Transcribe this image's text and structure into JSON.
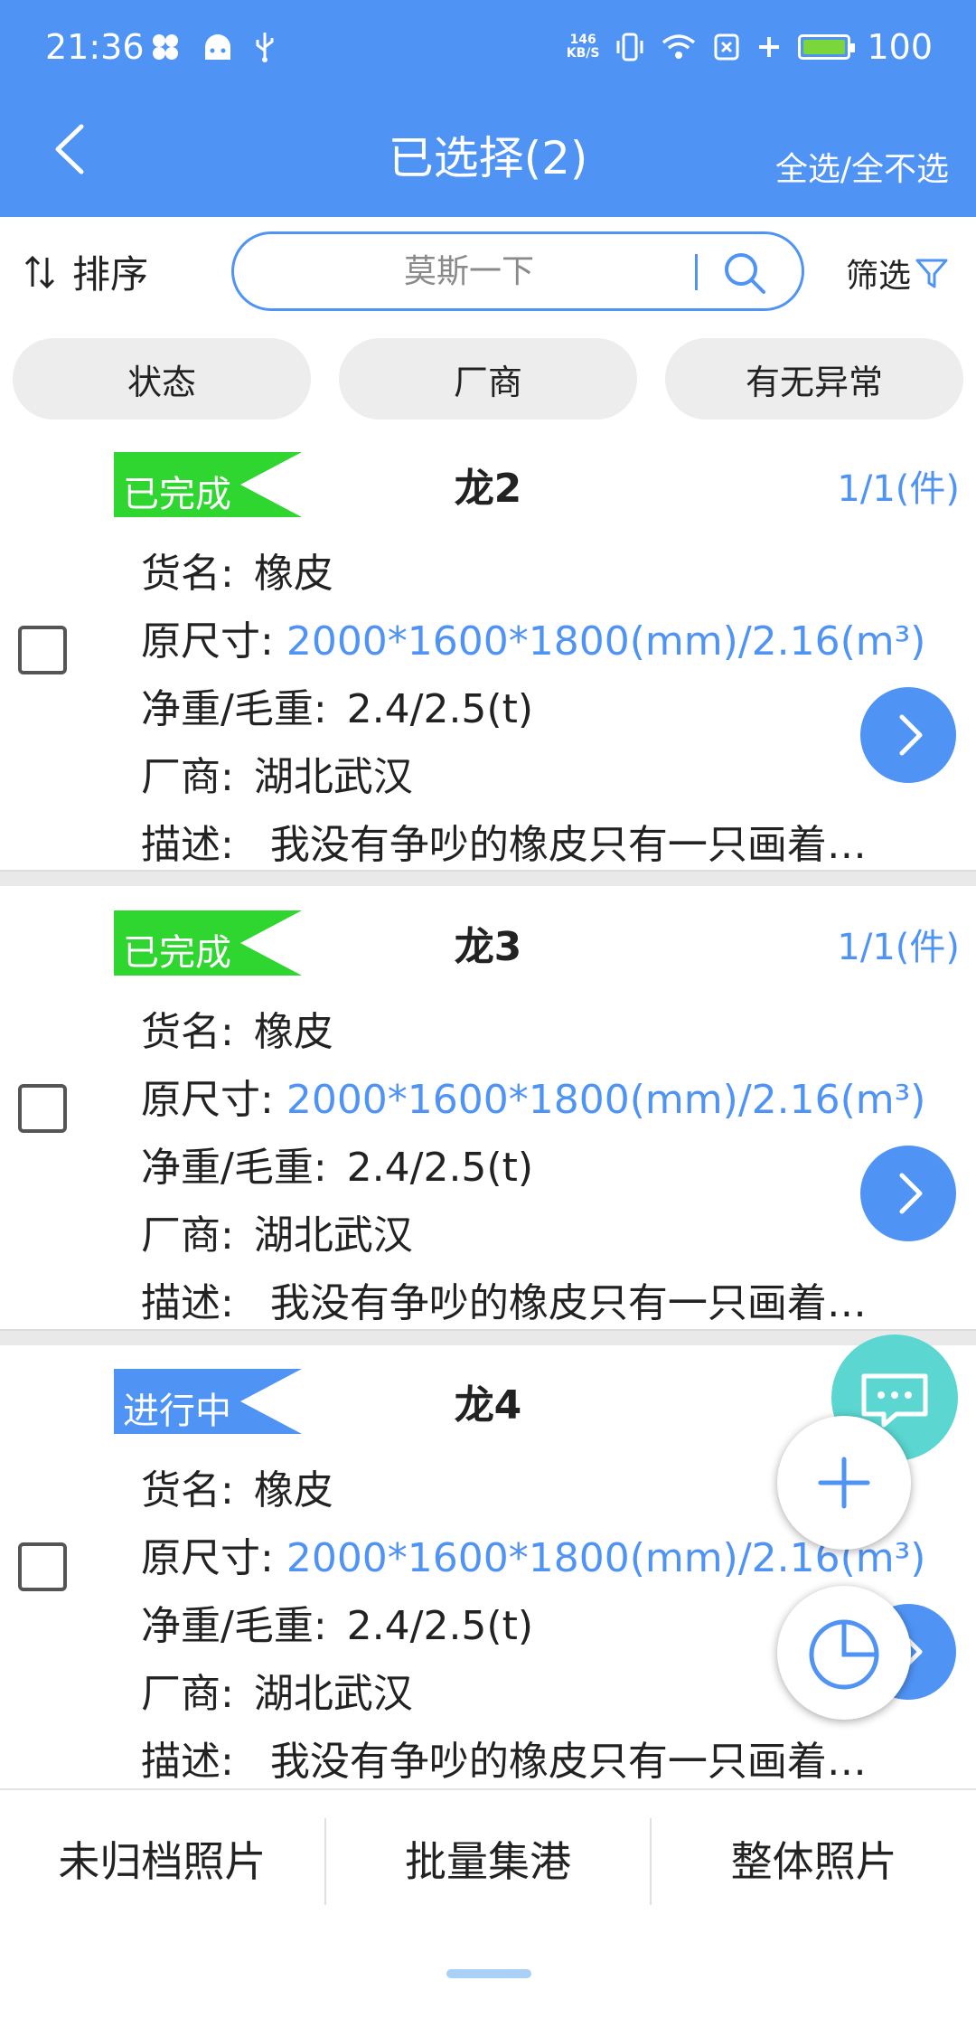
{
  "status_bar": {
    "time": "21:36",
    "speed_value": "146",
    "speed_unit": "KB/S",
    "battery": "100",
    "icons": [
      "flower-icon",
      "android-icon",
      "usb-icon",
      "vibrate-icon",
      "wifi-icon",
      "sim-icon",
      "plus-icon",
      "battery-icon"
    ]
  },
  "header": {
    "title": "已选择(2)",
    "select_all": "全选/全不选",
    "back_icon": "chevron-left-icon"
  },
  "toolbar": {
    "sort_label": "排序",
    "search_placeholder": "莫斯一下",
    "filter_label": "筛选"
  },
  "chips": [
    {
      "label": "状态"
    },
    {
      "label": "厂商"
    },
    {
      "label": "有无异常"
    }
  ],
  "cards": [
    {
      "status": "已完成",
      "status_color": "#2fd62f",
      "name": "龙2",
      "count": "1/1(件)",
      "goods_label": "货名:",
      "goods_value": "橡皮",
      "size_label": "原尺寸:",
      "size_value": "2000*1600*1800(mm)/2.16(m³)",
      "weight_label": "净重/毛重:",
      "weight_value": "2.4/2.5(t)",
      "vendor_label": "厂商:",
      "vendor_value": "湖北武汉",
      "desc_label": "描述:",
      "desc_value": "我没有争吵的橡皮只有一只画着小红花的铅笔"
    },
    {
      "status": "已完成",
      "status_color": "#2fd62f",
      "name": "龙3",
      "count": "1/1(件)",
      "goods_label": "货名:",
      "goods_value": "橡皮",
      "size_label": "原尺寸:",
      "size_value": "2000*1600*1800(mm)/2.16(m³)",
      "weight_label": "净重/毛重:",
      "weight_value": "2.4/2.5(t)",
      "vendor_label": "厂商:",
      "vendor_value": "湖北武汉",
      "desc_label": "描述:",
      "desc_value": "我没有争吵的橡皮只有一只画着小红花的铅笔"
    },
    {
      "status": "进行中",
      "status_color": "#4f94f5",
      "name": "龙4",
      "count": "",
      "goods_label": "货名:",
      "goods_value": "橡皮",
      "size_label": "原尺寸:",
      "size_value": "2000*1600*1800(mm)/2.16(m³)",
      "weight_label": "净重/毛重:",
      "weight_value": "2.4/2.5(t)",
      "vendor_label": "厂商:",
      "vendor_value": "湖北武汉",
      "desc_label": "描述:",
      "desc_value": "我没有争吵的橡皮只有一只画着小红花的铅笔"
    }
  ],
  "bottom_bar": [
    {
      "label": "未归档照片"
    },
    {
      "label": "批量集港"
    },
    {
      "label": "整体照片"
    }
  ],
  "colors": {
    "primary": "#4f94f5",
    "done": "#2fd62f",
    "chat_fab": "#5bd6d0"
  }
}
